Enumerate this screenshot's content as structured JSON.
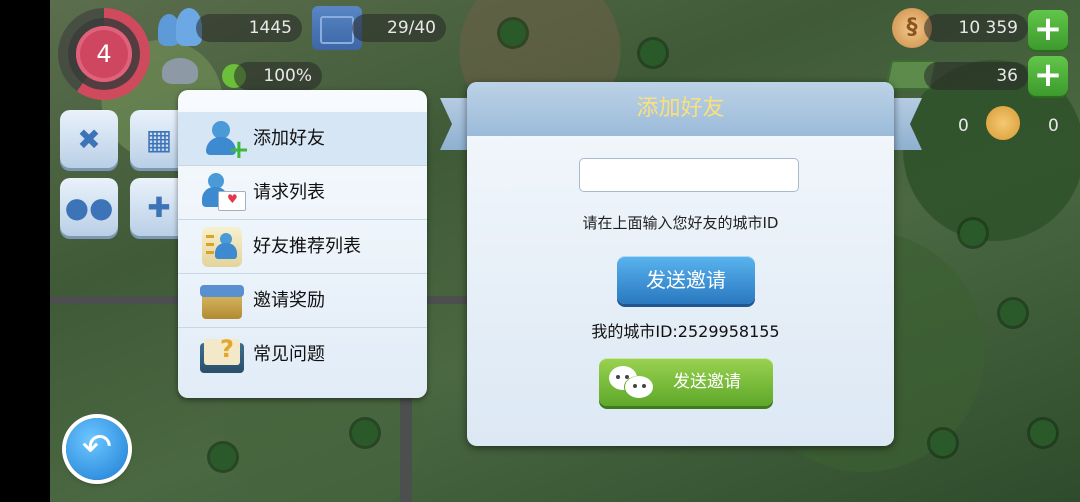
{
  "hud": {
    "level": "4",
    "population": "1445",
    "storage": "29/40",
    "happiness": "100%",
    "simoleons": "10 359",
    "simcash": "36",
    "tokens": "0",
    "keys": "0",
    "coin_symbol": "§"
  },
  "menu": {
    "items": [
      {
        "label": "添加好友"
      },
      {
        "label": "请求列表"
      },
      {
        "label": "好友推荐列表"
      },
      {
        "label": "邀请奖励"
      },
      {
        "label": "常见问题"
      }
    ]
  },
  "dialog": {
    "title": "添加好友",
    "input_value": "",
    "hint": "请在上面输入您好友的城市ID",
    "send_button": "发送邀请",
    "my_city_id": "我的城市ID:2529958155",
    "wechat_button": "发送邀请"
  },
  "colors": {
    "title_text": "#fbe07a",
    "blue_button": "#2a78c0",
    "green_button": "#5ea82a"
  },
  "icons": {
    "back": "undo-arrow-icon",
    "add_friend": "add-user-icon",
    "requests": "user-mail-icon",
    "recommend": "user-list-icon",
    "reward": "gift-box-icon",
    "faq": "question-book-icon",
    "wechat": "wechat-icon"
  }
}
